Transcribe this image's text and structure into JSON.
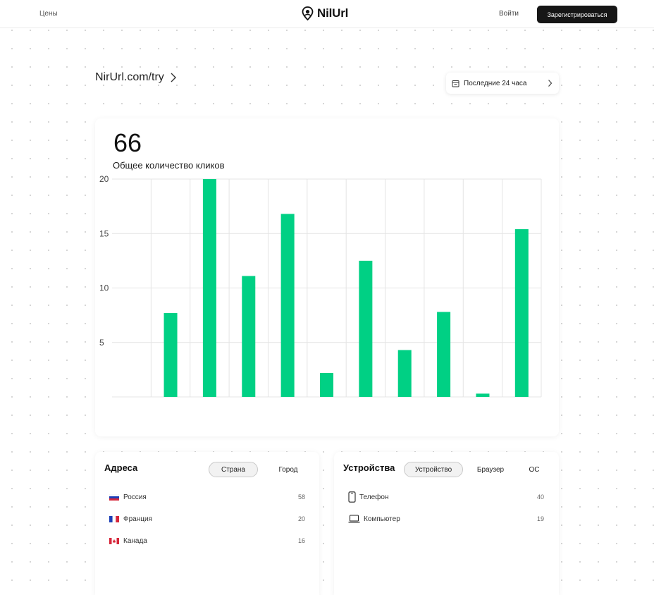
{
  "header": {
    "pricing_label": "Цены",
    "brand": "NilUrl",
    "login_label": "Войти",
    "signup_label": "Зарегистрироваться"
  },
  "link": {
    "title": "NirUrl.com/try"
  },
  "range": {
    "label": "Последние 24 часа",
    "icon": "calendar-icon"
  },
  "stats": {
    "total": "66",
    "total_label": "Общее количество кликов"
  },
  "chart_data": {
    "type": "bar",
    "categories": [
      "",
      "",
      "",
      "",
      "",
      "",
      "",
      "",
      "",
      "",
      ""
    ],
    "values": [
      0,
      7.7,
      20,
      11.1,
      16.8,
      2.2,
      12.5,
      4.3,
      7.8,
      0.3,
      15.4
    ],
    "ylim": [
      0,
      20
    ],
    "yticks": [
      5,
      10,
      15,
      20
    ],
    "grid": true,
    "bar_color": "#00d084",
    "grid_color": "#e4e4e4"
  },
  "addresses": {
    "title": "Адреса",
    "tabs": [
      "Страна",
      "Город"
    ],
    "active_tab": 0,
    "items": [
      {
        "label": "Россия",
        "value": "58",
        "flag": "flag-russia-icon"
      },
      {
        "label": "Франция",
        "value": "20",
        "flag": "flag-france-icon"
      },
      {
        "label": "Канада",
        "value": "16",
        "flag": "flag-canada-icon"
      }
    ]
  },
  "devices": {
    "title": "Устройства",
    "tabs": [
      "Устройство",
      "Браузер",
      "ОС"
    ],
    "active_tab": 0,
    "items": [
      {
        "label": "Телефон",
        "value": "40",
        "icon": "phone-icon"
      },
      {
        "label": "Компьютер",
        "value": "19",
        "icon": "laptop-icon"
      }
    ]
  },
  "colors": {
    "accent": "#00d084",
    "primary_button": "#161616"
  }
}
